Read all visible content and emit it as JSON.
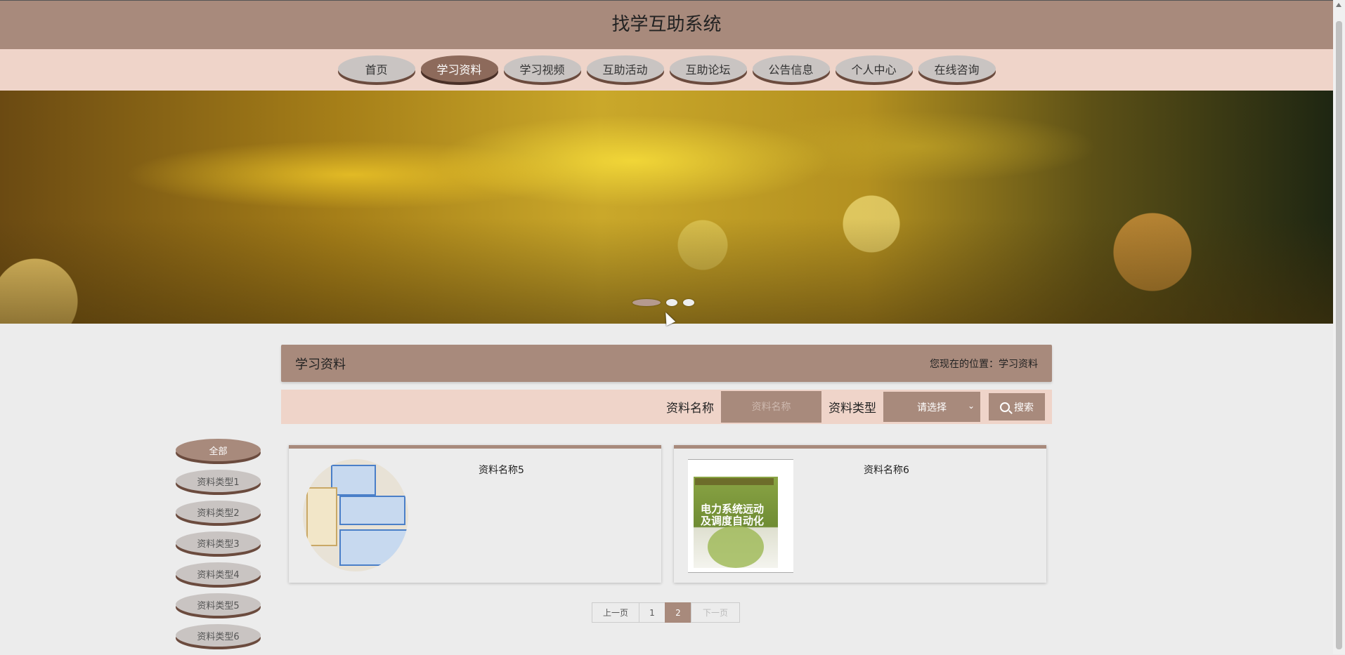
{
  "header": {
    "title": "找学互助系统"
  },
  "nav": {
    "items": [
      {
        "label": "首页"
      },
      {
        "label": "学习资料",
        "active": true
      },
      {
        "label": "学习视频"
      },
      {
        "label": "互助活动"
      },
      {
        "label": "互助论坛"
      },
      {
        "label": "公告信息"
      },
      {
        "label": "个人中心"
      },
      {
        "label": "在线咨询"
      }
    ]
  },
  "banner": {
    "slide_count": 3,
    "active_slide": 1
  },
  "section": {
    "title": "学习资料",
    "breadcrumb": "您现在的位置：学习资料"
  },
  "search": {
    "name_label": "资料名称",
    "name_placeholder": "资料名称",
    "type_label": "资料类型",
    "type_selected": "请选择",
    "button_label": "搜索"
  },
  "categories": [
    {
      "label": "全部",
      "active": true
    },
    {
      "label": "资料类型1"
    },
    {
      "label": "资料类型2"
    },
    {
      "label": "资料类型3"
    },
    {
      "label": "资料类型4"
    },
    {
      "label": "资料类型5"
    },
    {
      "label": "资料类型6"
    }
  ],
  "items": [
    {
      "name": "资料名称5",
      "cover_text": ""
    },
    {
      "name": "资料名称6",
      "cover_text": "电力系统远动及调度自动化"
    }
  ],
  "pagination": {
    "prev": "上一页",
    "pages": [
      "1",
      "2"
    ],
    "current": "2",
    "next": "下一页"
  },
  "colors": {
    "brand": "#a88a7c",
    "nav_bg": "#efd4c9",
    "page_bg": "#ececec"
  }
}
